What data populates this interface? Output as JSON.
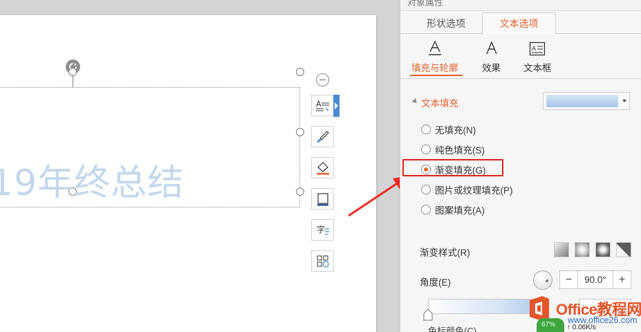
{
  "panel": {
    "title_partial": "对象属性",
    "tabs": [
      {
        "label": "形状选项",
        "active": false
      },
      {
        "label": "文本选项",
        "active": true
      }
    ],
    "subtabs": [
      {
        "label": "填充与轮廓",
        "icon": "text-fill-outline-icon",
        "active": true
      },
      {
        "label": "效果",
        "icon": "text-effect-icon",
        "active": false
      },
      {
        "label": "文本框",
        "icon": "text-box-icon",
        "active": false
      }
    ],
    "section": {
      "title": "文本填充",
      "options": [
        {
          "label": "无填充(N)",
          "selected": false
        },
        {
          "label": "纯色填充(S)",
          "selected": false
        },
        {
          "label": "渐变填充(G)",
          "selected": true
        },
        {
          "label": "图片或纹理填充(P)",
          "selected": false
        },
        {
          "label": "图案填充(A)",
          "selected": false
        }
      ]
    },
    "gradient_style_label": "渐变样式(R)",
    "angle_label": "角度(E)",
    "angle_value": "90.0°",
    "bottom_label_partial": "色标颜色(C)"
  },
  "slide": {
    "text": "19年终总结"
  },
  "float_tools": [
    "text-style-icon",
    "brush-icon",
    "fill-bucket-icon",
    "border-icon",
    "text-wrap-icon",
    "layout-icon"
  ],
  "watermark": {
    "brand": "Office教程网",
    "url": "www.office26.com"
  },
  "net_monitor": {
    "percent": "67%",
    "speed": "↑ 0.06K/s"
  },
  "colors": {
    "accent": "#e3622d",
    "highlight_box": "#e0211d",
    "arrow": "#ee2a24",
    "slide_text": "#c4d8ec"
  }
}
